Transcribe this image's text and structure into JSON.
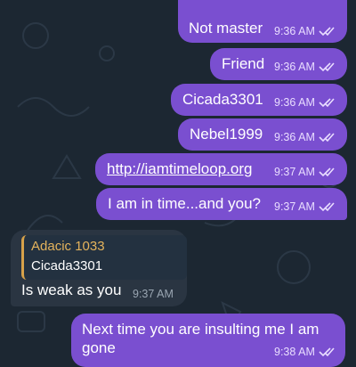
{
  "messages": [
    {
      "text": "Not master",
      "time": "9:36 AM"
    },
    {
      "text": "Friend",
      "time": "9:36 AM"
    },
    {
      "text": "Cicada3301",
      "time": "9:36 AM"
    },
    {
      "text": "Nebel1999",
      "time": "9:36 AM"
    },
    {
      "text": "http://iamtimeloop.org",
      "time": "9:37 AM"
    },
    {
      "text": "I am in time...and you?",
      "time": "9:37 AM"
    },
    {
      "text": "Is weak as you",
      "time": "9:37 AM",
      "reply_name": "Adacic 1033",
      "reply_text": "Cicada3301"
    },
    {
      "text_line1": "Next time you are insulting me I am",
      "text_line2": "gone",
      "time": "9:38 AM"
    }
  ],
  "colors": {
    "outgoing": "#7a4fd0",
    "incoming": "#2a3542",
    "background": "#1c2732",
    "reply_accent": "#d7a24a"
  },
  "icons": [
    "double-check-icon"
  ]
}
